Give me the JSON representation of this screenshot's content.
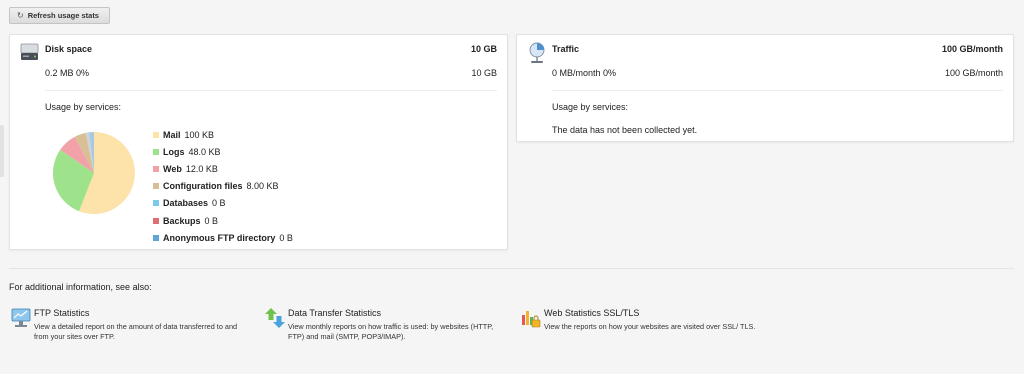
{
  "toolbar": {
    "refresh_label": "Refresh usage stats"
  },
  "disk": {
    "title": "Disk space",
    "total": "10 GB",
    "used": "0.2 MB 0%",
    "limit": "10 GB",
    "services_label": "Usage by services:",
    "legend": [
      {
        "name": "Mail",
        "value": "100 KB",
        "color": "#fde2a9"
      },
      {
        "name": "Logs",
        "value": "48.0 KB",
        "color": "#9ee38c"
      },
      {
        "name": "Web",
        "value": "12.0 KB",
        "color": "#f3a1a8"
      },
      {
        "name": "Configuration files",
        "value": "8.00 KB",
        "color": "#d8bf95"
      },
      {
        "name": "Databases",
        "value": "0 B",
        "color": "#7cc9ef"
      },
      {
        "name": "Backups",
        "value": "0 B",
        "color": "#dd6f73"
      },
      {
        "name": "Anonymous FTP directory",
        "value": "0 B",
        "color": "#5fa5d6"
      }
    ]
  },
  "traffic": {
    "title": "Traffic",
    "total": "100 GB/month",
    "used": "0 MB/month 0%",
    "limit": "100 GB/month",
    "services_label": "Usage by services:",
    "no_data": "The data has not been collected yet."
  },
  "see_also": {
    "heading": "For additional information, see also:",
    "links": [
      {
        "title": "FTP Statistics",
        "description": "View a detailed report on the amount of data transferred to and from your sites over FTP.",
        "icon": "ftp-statistics-icon"
      },
      {
        "title": "Data Transfer Statistics",
        "description": "View monthly reports on how traffic is used: by websites (HTTP, FTP) and mail (SMTP, POP3/IMAP).",
        "icon": "data-transfer-icon"
      },
      {
        "title": "Web Statistics SSL/TLS",
        "description": "View the reports on how your websites are visited over SSL/ TLS.",
        "icon": "web-statistics-icon"
      }
    ]
  }
}
